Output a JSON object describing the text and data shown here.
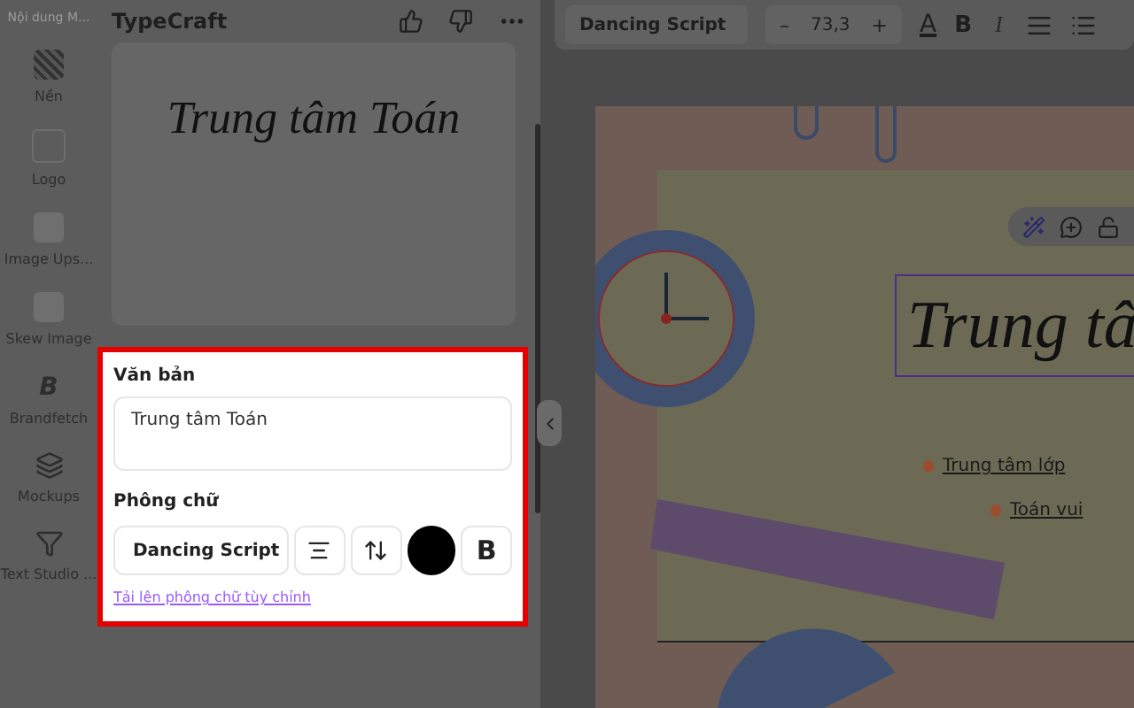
{
  "rail": {
    "header": "Nội dung M...",
    "items": [
      {
        "label": "Nền",
        "kind": "pattern"
      },
      {
        "label": "Logo",
        "kind": "blank"
      },
      {
        "label": "Image Ups...",
        "kind": "image"
      },
      {
        "label": "Skew Image",
        "kind": "image"
      },
      {
        "label": "Brandfetch",
        "kind": "letter",
        "glyph": "B"
      },
      {
        "label": "Mockups",
        "kind": "layers"
      },
      {
        "label": "Text Studio ...",
        "kind": "funnel"
      }
    ]
  },
  "panel": {
    "title": "TypeCraft",
    "preview_text": "Trung tâm Toán"
  },
  "editor": {
    "text_label": "Văn bản",
    "text_value": "Trung tâm Toán",
    "font_label": "Phông chữ",
    "font": "Dancing Script",
    "bold": "B",
    "upload_link": "Tải lên phông chữ tùy chỉnh"
  },
  "toolbar": {
    "font": "Dancing Script",
    "minus": "–",
    "size": "73,3",
    "plus": "+",
    "color_letter": "A",
    "bold": "B",
    "italic": "I"
  },
  "canvas": {
    "title": "Trung tâ",
    "bullets": [
      "Trung tâm lớp",
      "Toán vui"
    ]
  }
}
